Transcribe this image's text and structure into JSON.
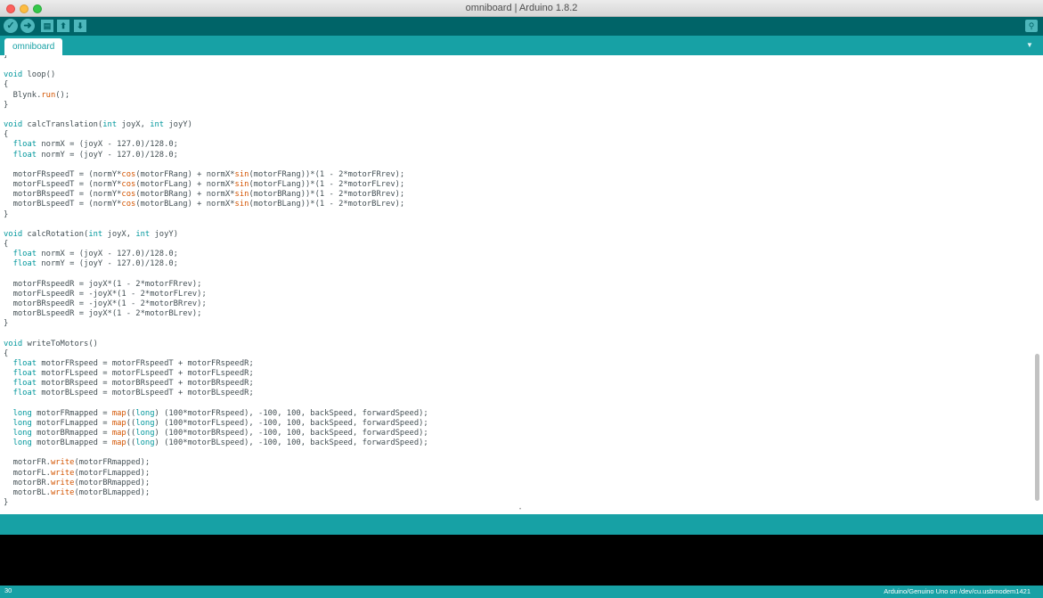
{
  "window": {
    "title": "omniboard | Arduino 1.8.2"
  },
  "toolbar": {
    "verify_icon": "check-icon",
    "upload_icon": "arrow-right-icon",
    "new_icon": "new-file-icon",
    "open_icon": "arrow-up-icon",
    "save_icon": "arrow-down-icon",
    "serial_monitor_icon": "magnifier-icon"
  },
  "tabs": [
    {
      "label": "omniboard"
    }
  ],
  "editor": {
    "lines": [
      "}",
      "",
      "void loop()",
      "{",
      "  Blynk.run();",
      "}",
      "",
      "void calcTranslation(int joyX, int joyY)",
      "{",
      "  float normX = (joyX - 127.0)/128.0;",
      "  float normY = (joyY - 127.0)/128.0;",
      "",
      "  motorFRspeedT = (normY*cos(motorFRang) + normX*sin(motorFRang))*(1 - 2*motorFRrev);",
      "  motorFLspeedT = (normY*cos(motorFLang) + normX*sin(motorFLang))*(1 - 2*motorFLrev);",
      "  motorBRspeedT = (normY*cos(motorBRang) + normX*sin(motorBRang))*(1 - 2*motorBRrev);",
      "  motorBLspeedT = (normY*cos(motorBLang) + normX*sin(motorBLang))*(1 - 2*motorBLrev);",
      "}",
      "",
      "void calcRotation(int joyX, int joyY)",
      "{",
      "  float normX = (joyX - 127.0)/128.0;",
      "  float normY = (joyY - 127.0)/128.0;",
      "",
      "  motorFRspeedR = joyX*(1 - 2*motorFRrev);",
      "  motorFLspeedR = -joyX*(1 - 2*motorFLrev);",
      "  motorBRspeedR = -joyX*(1 - 2*motorBRrev);",
      "  motorBLspeedR = joyX*(1 - 2*motorBLrev);",
      "}",
      "",
      "void writeToMotors()",
      "{",
      "  float motorFRspeed = motorFRspeedT + motorFRspeedR;",
      "  float motorFLspeed = motorFLspeedT + motorFLspeedR;",
      "  float motorBRspeed = motorBRspeedT + motorBRspeedR;",
      "  float motorBLspeed = motorBLspeedT + motorBLspeedR;",
      "",
      "  long motorFRmapped = map((long) (100*motorFRspeed), -100, 100, backSpeed, forwardSpeed);",
      "  long motorFLmapped = map((long) (100*motorFLspeed), -100, 100, backSpeed, forwardSpeed);",
      "  long motorBRmapped = map((long) (100*motorBRspeed), -100, 100, backSpeed, forwardSpeed);",
      "  long motorBLmapped = map((long) (100*motorBLspeed), -100, 100, backSpeed, forwardSpeed);",
      "",
      "  motorFR.write(motorFRmapped);",
      "  motorFL.write(motorFLmapped);",
      "  motorBR.write(motorBRmapped);",
      "  motorBL.write(motorBLmapped);",
      "}"
    ],
    "keywords": [
      "void",
      "int",
      "float",
      "long"
    ],
    "functions": [
      "cos",
      "sin",
      "map",
      "write",
      "run"
    ]
  },
  "status": {
    "line_number": "30",
    "board_info": "Arduino/Genuino Uno on /dev/cu.usbmodem1421"
  },
  "colors": {
    "toolbar": "#006468",
    "tabbar": "#17a1a5",
    "keyword": "#00979c",
    "function": "#d35400"
  }
}
